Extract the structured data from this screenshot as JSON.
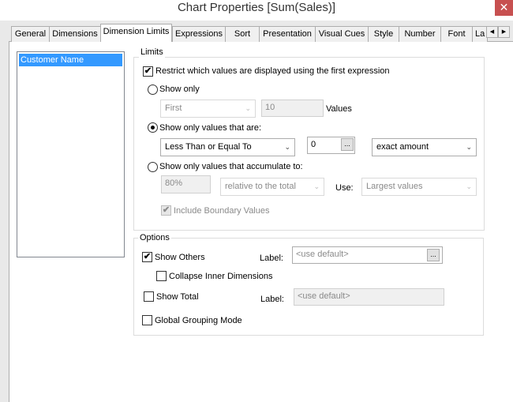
{
  "window": {
    "title": "Chart Properties [Sum(Sales)]",
    "close": "✕"
  },
  "tabs": [
    "General",
    "Dimensions",
    "Dimension Limits",
    "Expressions",
    "Sort",
    "Presentation",
    "Visual Cues",
    "Style",
    "Number",
    "Font",
    "La"
  ],
  "active_tab": "Dimension Limits",
  "tab_scroll": {
    "left": "◀",
    "right": "▶"
  },
  "dimensions_list": {
    "items": [
      "Customer Name"
    ],
    "selected": "Customer Name"
  },
  "limits": {
    "legend": "Limits",
    "restrict_label": "Restrict which values are displayed using the first expression",
    "restrict_checked": true,
    "show_only": {
      "label": "Show only",
      "selected": false,
      "dropdown": "First",
      "value": "10",
      "suffix": "Values"
    },
    "show_values_that_are": {
      "label": "Show only values that are:",
      "selected": true,
      "operator": "Less Than or Equal To",
      "value": "0",
      "mode": "exact amount"
    },
    "accumulate": {
      "label": "Show only values that accumulate to:",
      "selected": false,
      "value": "80%",
      "relative": "relative to the total",
      "use_label": "Use:",
      "use_value": "Largest values"
    },
    "include_boundary": {
      "label": "Include Boundary Values",
      "checked": true,
      "disabled": true
    },
    "ellipsis": "..."
  },
  "options": {
    "legend": "Options",
    "show_others": {
      "label": "Show Others",
      "checked": true,
      "label_field_label": "Label:",
      "placeholder": "<use default>"
    },
    "collapse_inner": {
      "label": "Collapse Inner Dimensions",
      "checked": false
    },
    "show_total": {
      "label": "Show Total",
      "checked": false,
      "label_field_label": "Label:",
      "placeholder": "<use default>"
    },
    "global_grouping": {
      "label": "Global Grouping Mode",
      "checked": false
    },
    "ellipsis": "..."
  },
  "colors": {
    "selection": "#3399ff",
    "close": "#c75050"
  }
}
